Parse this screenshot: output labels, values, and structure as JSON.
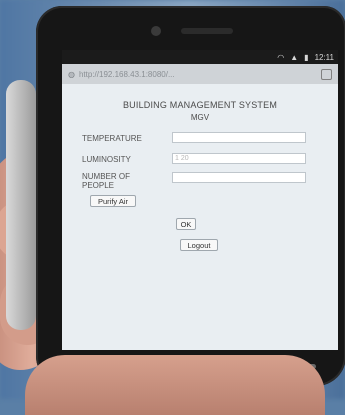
{
  "status_bar": {
    "time": "12:11"
  },
  "browser": {
    "url_text": "http://192.168.43.1:8080/..."
  },
  "app": {
    "title": "BUILDING MANAGEMENT SYSTEM",
    "subtitle": "MGV",
    "fields": [
      {
        "label": "TEMPERATURE",
        "value": ""
      },
      {
        "label": "LUMINOSITY",
        "value": "1 20"
      },
      {
        "label": "NUMBER OF PEOPLE",
        "value": ""
      }
    ],
    "purify_button": "Purify Air",
    "ok_button": "OK",
    "logout_button": "Logout"
  }
}
